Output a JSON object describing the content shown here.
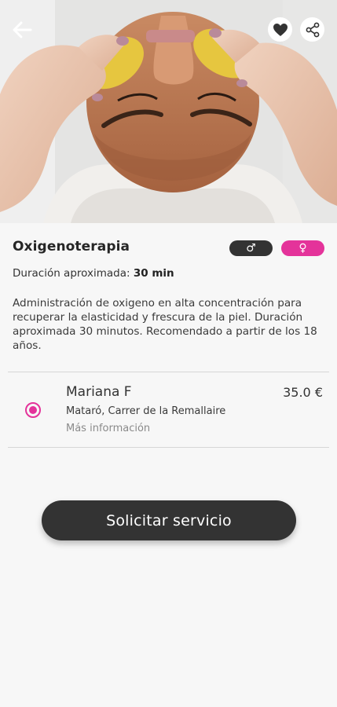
{
  "header": {
    "back_icon": "arrow-left-icon",
    "favorite_icon": "heart-icon",
    "share_icon": "share-icon"
  },
  "service": {
    "title": "Oxigenoterapia",
    "gender_male_symbol": "♂",
    "gender_female_symbol": "♀",
    "duration_label": "Duración aproximada:",
    "duration_value": "30 min",
    "description": "Administración de oxigeno en alta concentración para recuperar la elasticidad y frescura de la piel. Duración aproximada 30 minutos. Recomendado a partir de los 18 años."
  },
  "provider": {
    "name": "Mariana F",
    "price": "35.0 €",
    "address": "Mataró, Carrer de la Remallaire",
    "more_info": "Más información",
    "selected": true
  },
  "cta": {
    "label": "Solicitar servicio"
  },
  "colors": {
    "accent": "#e4339a",
    "dark": "#333333",
    "background": "#f7f7f7"
  }
}
